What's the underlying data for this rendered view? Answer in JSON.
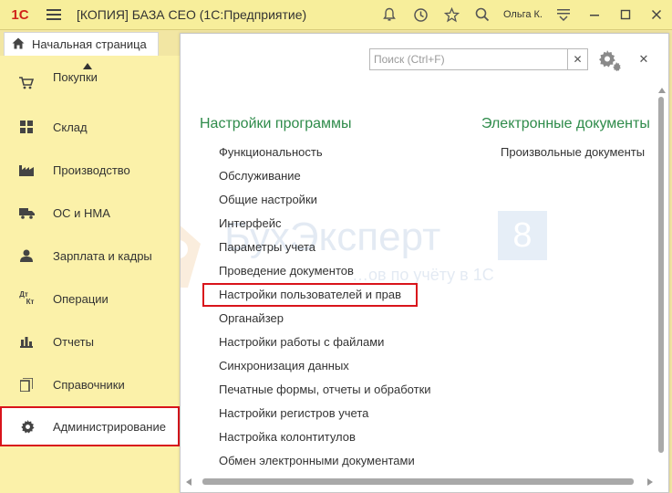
{
  "titlebar": {
    "logo": "1С",
    "title": "[КОПИЯ] БАЗА СЕО  (1С:Предприятие)",
    "user": "Ольга К."
  },
  "tabs": {
    "home": "Начальная страница"
  },
  "sidebar": {
    "items": [
      {
        "label": "Покупки",
        "icon": "cart-icon"
      },
      {
        "label": "Склад",
        "icon": "warehouse-icon"
      },
      {
        "label": "Производство",
        "icon": "factory-icon"
      },
      {
        "label": "ОС и НМА",
        "icon": "truck-icon"
      },
      {
        "label": "Зарплата и кадры",
        "icon": "person-icon"
      },
      {
        "label": "Операции",
        "icon": "dt-kt-icon"
      },
      {
        "label": "Отчеты",
        "icon": "bar-chart-icon"
      },
      {
        "label": "Справочники",
        "icon": "books-icon"
      },
      {
        "label": "Администрирование",
        "icon": "gear-icon"
      }
    ],
    "dt_kt": {
      "dt": "Дт",
      "kt": "Кт"
    }
  },
  "search": {
    "placeholder": "Поиск (Ctrl+F)",
    "value": ""
  },
  "left_section": {
    "title": "Настройки программы",
    "links": [
      "Функциональность",
      "Обслуживание",
      "Общие настройки",
      "Интерфейс",
      "Параметры учета",
      "Проведение документов",
      "Настройки пользователей и прав",
      "Органайзер",
      "Настройки работы с файлами",
      "Синхронизация данных",
      "Печатные формы, отчеты и обработки",
      "Настройки регистров учета",
      "Настройка колонтитулов",
      "Обмен электронными документами"
    ]
  },
  "right_section": {
    "title": "Электронные документы",
    "links": [
      "Произвольные документы"
    ]
  },
  "watermark": {
    "brand": "БухЭксперт",
    "eight": "8",
    "tagline": "…ов по учёту в 1С"
  },
  "colors": {
    "accent_green": "#2e8b4a",
    "highlight_red": "#d9141b",
    "sidebar_bg": "#fbf1a9"
  }
}
